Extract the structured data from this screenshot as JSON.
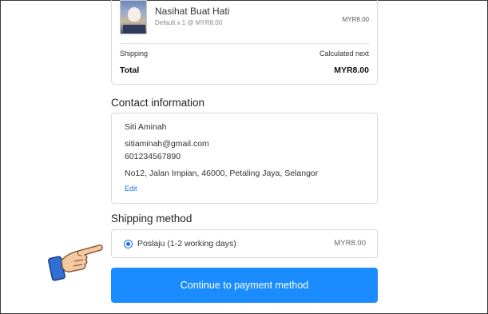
{
  "order_summary": {
    "product_name": "Nasihat Buat Hati",
    "product_variant": "Default x 1 @ MYR8.00",
    "product_price": "MYR8.00",
    "shipping_label": "Shipping",
    "shipping_value": "Calculated next",
    "total_label": "Total",
    "total_value": "MYR8.00"
  },
  "contact": {
    "title": "Contact information",
    "name": "Siti Aminah",
    "email": "sitiaminah@gmail.com",
    "phone": "601234567890",
    "address": "No12, Jalan Impian, 46000, Petaling Jaya, Selangor",
    "edit_label": "Edit"
  },
  "shipping_method": {
    "title": "Shipping method",
    "option_label": "Poslaju (1-2 working days)",
    "option_price": "MYR8.00",
    "selected": true
  },
  "continue_button": {
    "label": "Continue to payment method"
  },
  "colors": {
    "accent": "#1a8cff",
    "link": "#1a73e8",
    "border": "#d9d9d9"
  },
  "icons": {
    "pointer": "hand-pointer-icon",
    "radio": "radio-selected-icon"
  }
}
